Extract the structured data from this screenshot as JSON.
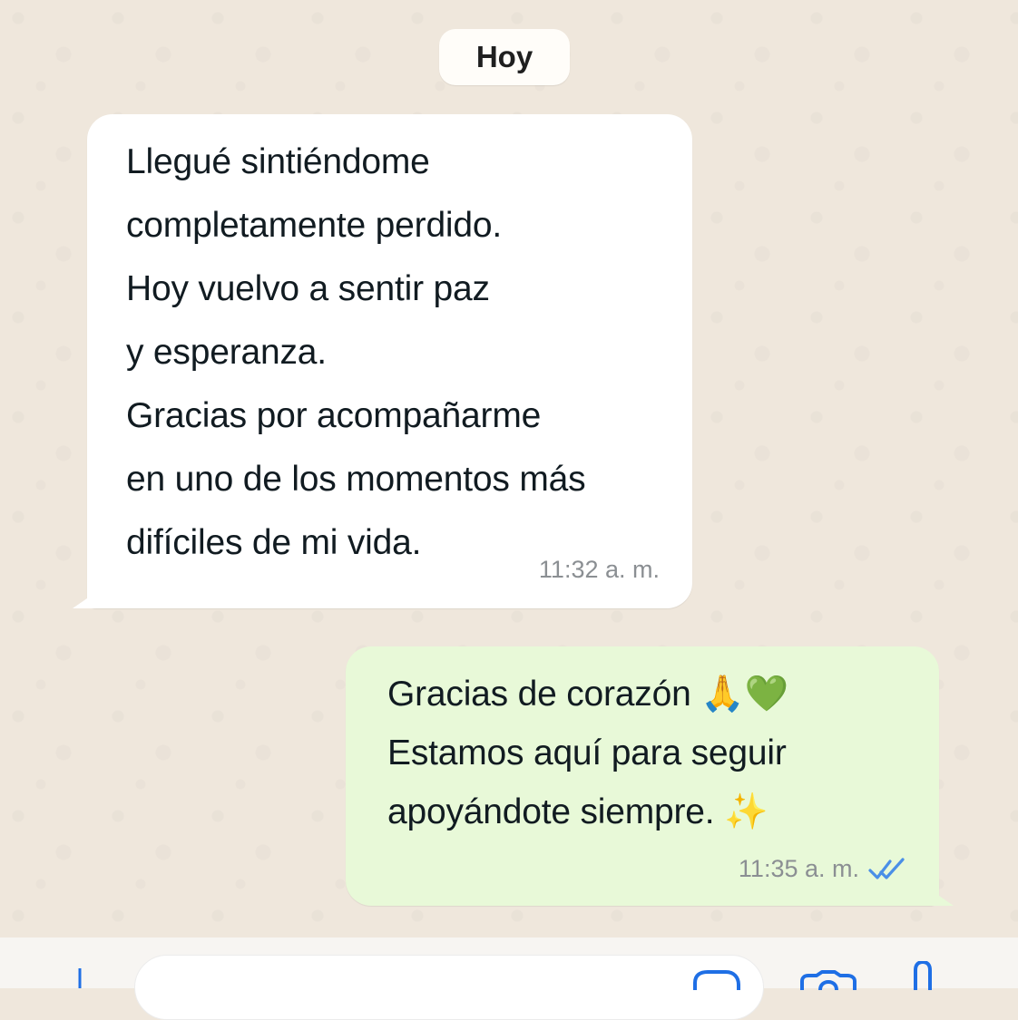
{
  "chat": {
    "date_pill": "Hoy",
    "incoming": {
      "text": "Llegué sintiéndome\ncompletamente perdido.\nHoy vuelvo a sentir paz\ny esperanza.\nGracias por acompañarme\nen uno de los momentos más\ndifíciles de mi vida.",
      "time": "11:32 a. m."
    },
    "outgoing": {
      "text": "Gracias de corazón 🙏💚\nEstamos aquí para seguir\napoyándote siempre. ✨",
      "time": "11:35 a. m.",
      "status_icon": "double-check-icon",
      "status_color": "#4a8fe7"
    }
  },
  "composer": {
    "icons": [
      "plus-icon",
      "sticker-icon",
      "camera-icon",
      "mic-icon"
    ]
  },
  "colors": {
    "background": "#efe7dc",
    "incoming_bubble": "#ffffff",
    "outgoing_bubble": "#e8f9d8",
    "timestamp": "#8b8f93",
    "text": "#111b21"
  }
}
